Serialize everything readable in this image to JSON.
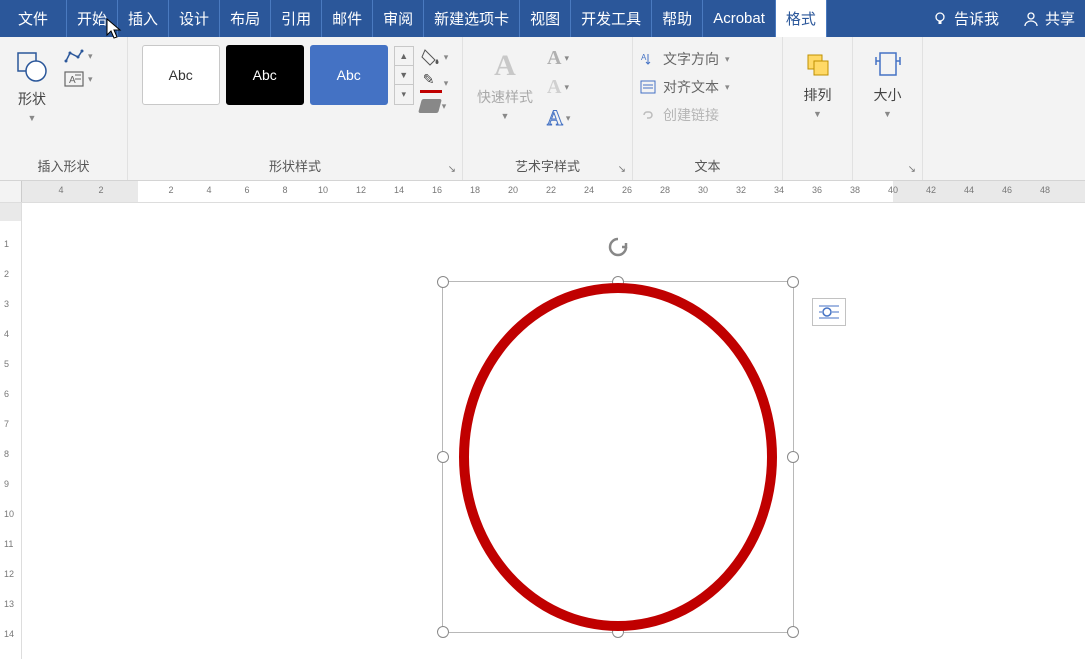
{
  "menu": {
    "tabs": [
      "文件",
      "开始",
      "插入",
      "设计",
      "布局",
      "引用",
      "邮件",
      "审阅",
      "新建选项卡",
      "视图",
      "开发工具",
      "帮助",
      "Acrobat",
      "格式"
    ],
    "active_index": 13,
    "tell_me": "告诉我",
    "share": "共享"
  },
  "ribbon": {
    "insert_shapes": {
      "shape_btn": "形状",
      "label": "插入形状"
    },
    "shape_styles": {
      "sample": "Abc",
      "label": "形状样式"
    },
    "wordart": {
      "quick": "快速样式",
      "label": "艺术字样式"
    },
    "text": {
      "direction": "文字方向",
      "align": "对齐文本",
      "link": "创建链接",
      "label": "文本"
    },
    "arrange": {
      "btn": "排列"
    },
    "size": {
      "btn": "大小"
    }
  },
  "ruler": {
    "h_left": [
      "4",
      "2"
    ],
    "h": [
      "2",
      "4",
      "6",
      "8",
      "10",
      "12",
      "14",
      "16",
      "18",
      "20",
      "22",
      "24",
      "26",
      "28",
      "30",
      "32",
      "34",
      "36",
      "38",
      "40",
      "42",
      "44",
      "46",
      "48"
    ],
    "v": [
      "1",
      "2",
      "3",
      "4",
      "5",
      "6",
      "7",
      "8",
      "9",
      "10",
      "11",
      "12",
      "13",
      "14"
    ]
  },
  "shape": {
    "color": "#c00000"
  }
}
